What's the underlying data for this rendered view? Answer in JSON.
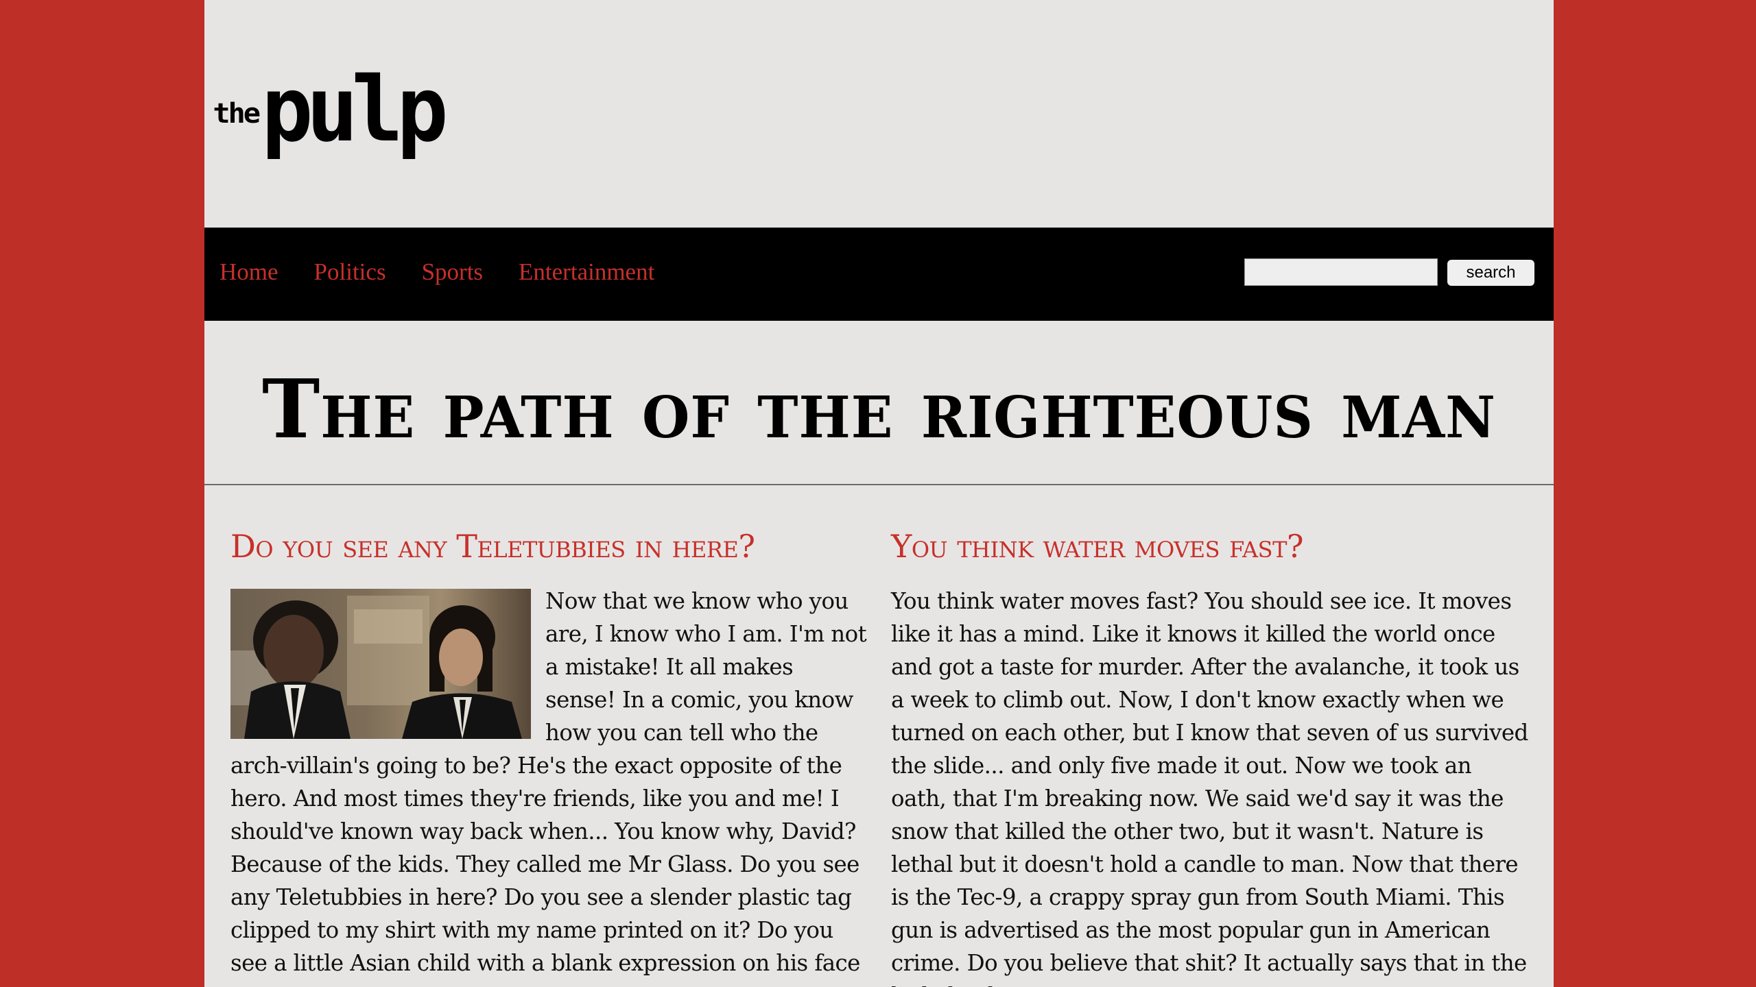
{
  "logo": {
    "the": "the",
    "pulp": "pulp"
  },
  "nav": {
    "items": [
      "Home",
      "Politics",
      "Sports",
      "Entertainment"
    ],
    "search_value": "",
    "search_button": "search"
  },
  "headline": "The path of the righteous man",
  "articles": [
    {
      "title": "Do you see any Teletubbies in here?",
      "image_icon": "two-men-in-suits-photo",
      "body": "Now that we know who you are, I know who I am. I'm not a mistake! It all makes sense! In a comic, you know how you can tell who the arch-villain's going to be? He's the exact opposite of the hero. And most times they're friends, like you and me! I should've known way back when... You know why, David? Because of the kids. They called me Mr Glass. Do you see any Teletubbies in here? Do you see a slender plastic tag clipped to my shirt with my name printed on it? Do you see a little Asian child with a blank expression on his face"
    },
    {
      "title": "You think water moves fast?",
      "body": "You think water moves fast? You should see ice. It moves like it has a mind. Like it knows it killed the world once and got a taste for murder. After the avalanche, it took us a week to climb out. Now, I don't know exactly when we turned on each other, but I know that seven of us survived the slide... and only five made it out. Now we took an oath, that I'm breaking now. We said we'd say it was the snow that killed the other two, but it wasn't. Nature is lethal but it doesn't hold a candle to man. Now that there is the Tec-9, a crappy spray gun from South Miami. This gun is advertised as the most popular gun in American crime. Do you believe that shit? It actually says that in the little book"
    }
  ],
  "colors": {
    "brand_red": "#c7302a",
    "background_red": "#bd2f27",
    "page_bg": "#e7e5e4",
    "nav_bg": "#000000"
  }
}
